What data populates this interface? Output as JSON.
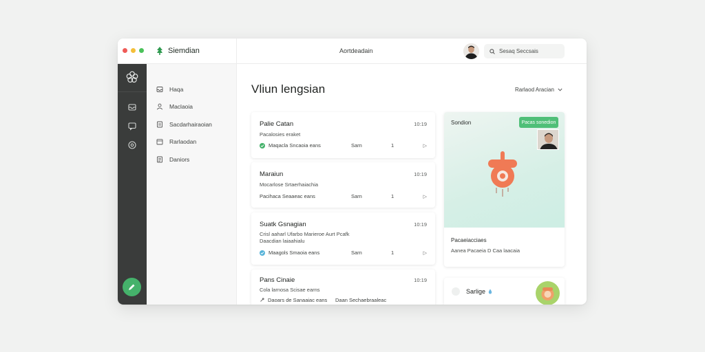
{
  "window": {
    "brand": "Siemdian",
    "center_title": "Aortdeadain",
    "search_placeholder": "Sesaq Seccsais"
  },
  "nav": {
    "items": [
      {
        "label": "Haqa",
        "icon": "inbox-icon"
      },
      {
        "label": "Maclaoia",
        "icon": "user-icon"
      },
      {
        "label": "Sacdarhairaoian",
        "icon": "document-icon"
      },
      {
        "label": "Rarlaodan",
        "icon": "calendar-icon"
      },
      {
        "label": "Daniors",
        "icon": "file-icon"
      }
    ]
  },
  "main": {
    "title": "Vliun lengsian",
    "filter_label": "Rarlaod Aracian"
  },
  "cards": [
    {
      "title": "Palie Catan",
      "time": "10:19",
      "desc": [
        "Pacalosies eraket"
      ],
      "status": "Maqacla Sncaoia eans",
      "status_color": "#45b26b",
      "meta": "Sarn",
      "count": "1",
      "arrow": "▷"
    },
    {
      "title": "Maraiun",
      "time": "10:19",
      "desc": [
        "Mocarlose Srtaerhaiachia"
      ],
      "status": "Pacihaca Seaaeac eans",
      "status_color": "",
      "meta": "Sarn",
      "count": "1",
      "arrow": "▷"
    },
    {
      "title": "Suatk Gsnagian",
      "time": "10:19",
      "desc": [
        "Crisl aaharl Ufarbo Marieroe Aurt Pcafk",
        "Daacdian laiaahialu"
      ],
      "status": "Maagols Smaoia eans",
      "status_color": "#56b3d9",
      "meta": "Sarn",
      "count": "1",
      "arrow": "▷"
    },
    {
      "title": "Pans Cinaie",
      "time": "10:19",
      "desc": [
        "Cola larnosa Scisae earns"
      ],
      "status": "Daoars de Sanaaiac eans",
      "status_color": "",
      "meta": "Daan Sechaebraaleac",
      "count": "",
      "arrow": ""
    }
  ],
  "preview": {
    "label": "Sondion",
    "badge": "Pacas sonedion",
    "name": "Pacaeiacciaes",
    "sub": "Aanea Pacaeia D Caa laacaia"
  },
  "mini": {
    "label": "Sarlige"
  },
  "colors": {
    "accent": "#45b26b",
    "rail": "#3a3c3b",
    "mascot": "#f07a55"
  }
}
